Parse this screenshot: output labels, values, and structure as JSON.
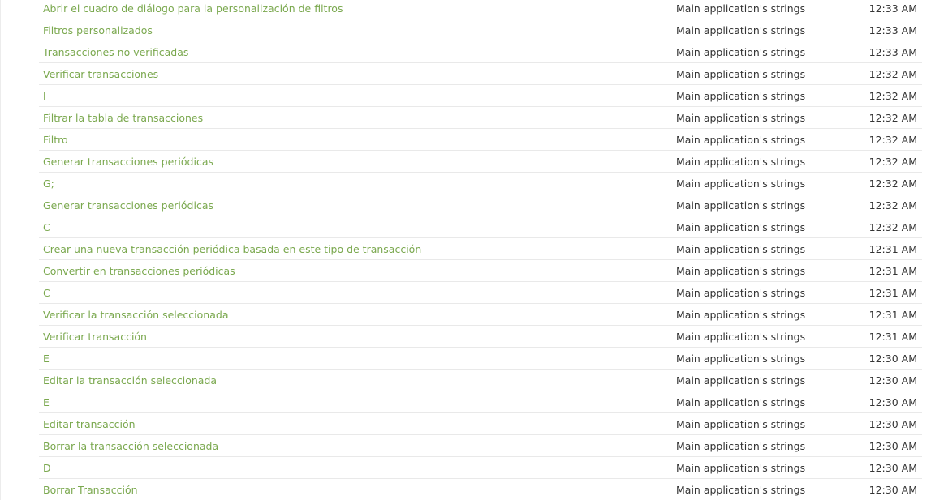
{
  "activity": {
    "rows": [
      {
        "text": "Abrir el cuadro de diálogo para la personalización de filtros",
        "resource": "Main application's strings",
        "time": "12:33 AM"
      },
      {
        "text": "Filtros personalizados",
        "resource": "Main application's strings",
        "time": "12:33 AM"
      },
      {
        "text": "Transacciones no verificadas",
        "resource": "Main application's strings",
        "time": "12:33 AM"
      },
      {
        "text": "Verificar transacciones",
        "resource": "Main application's strings",
        "time": "12:32 AM"
      },
      {
        "text": "l",
        "resource": "Main application's strings",
        "time": "12:32 AM"
      },
      {
        "text": "Filtrar la tabla de transacciones",
        "resource": "Main application's strings",
        "time": "12:32 AM"
      },
      {
        "text": "Filtro",
        "resource": "Main application's strings",
        "time": "12:32 AM"
      },
      {
        "text": "Generar transacciones periódicas",
        "resource": "Main application's strings",
        "time": "12:32 AM"
      },
      {
        "text": "G;",
        "resource": "Main application's strings",
        "time": "12:32 AM"
      },
      {
        "text": "Generar transacciones periódicas",
        "resource": "Main application's strings",
        "time": "12:32 AM"
      },
      {
        "text": "C",
        "resource": "Main application's strings",
        "time": "12:32 AM"
      },
      {
        "text": "Crear una nueva transacción periódica basada en este tipo de transacción",
        "resource": "Main application's strings",
        "time": "12:31 AM"
      },
      {
        "text": "Convertir en transacciones periódicas",
        "resource": "Main application's strings",
        "time": "12:31 AM"
      },
      {
        "text": "C",
        "resource": "Main application's strings",
        "time": "12:31 AM"
      },
      {
        "text": "Verificar la transacción seleccionada",
        "resource": "Main application's strings",
        "time": "12:31 AM"
      },
      {
        "text": "Verificar transacción",
        "resource": "Main application's strings",
        "time": "12:31 AM"
      },
      {
        "text": "E",
        "resource": "Main application's strings",
        "time": "12:30 AM"
      },
      {
        "text": "Editar la transacción seleccionada",
        "resource": "Main application's strings",
        "time": "12:30 AM"
      },
      {
        "text": "E",
        "resource": "Main application's strings",
        "time": "12:30 AM"
      },
      {
        "text": "Editar transacción",
        "resource": "Main application's strings",
        "time": "12:30 AM"
      },
      {
        "text": "Borrar la transacción seleccionada",
        "resource": "Main application's strings",
        "time": "12:30 AM"
      },
      {
        "text": "D",
        "resource": "Main application's strings",
        "time": "12:30 AM"
      },
      {
        "text": "Borrar Transacción",
        "resource": "Main application's strings",
        "time": "12:30 AM"
      }
    ]
  },
  "colors": {
    "link": "#7aa84e",
    "text": "#333333",
    "divider": "#e9e9e9"
  }
}
